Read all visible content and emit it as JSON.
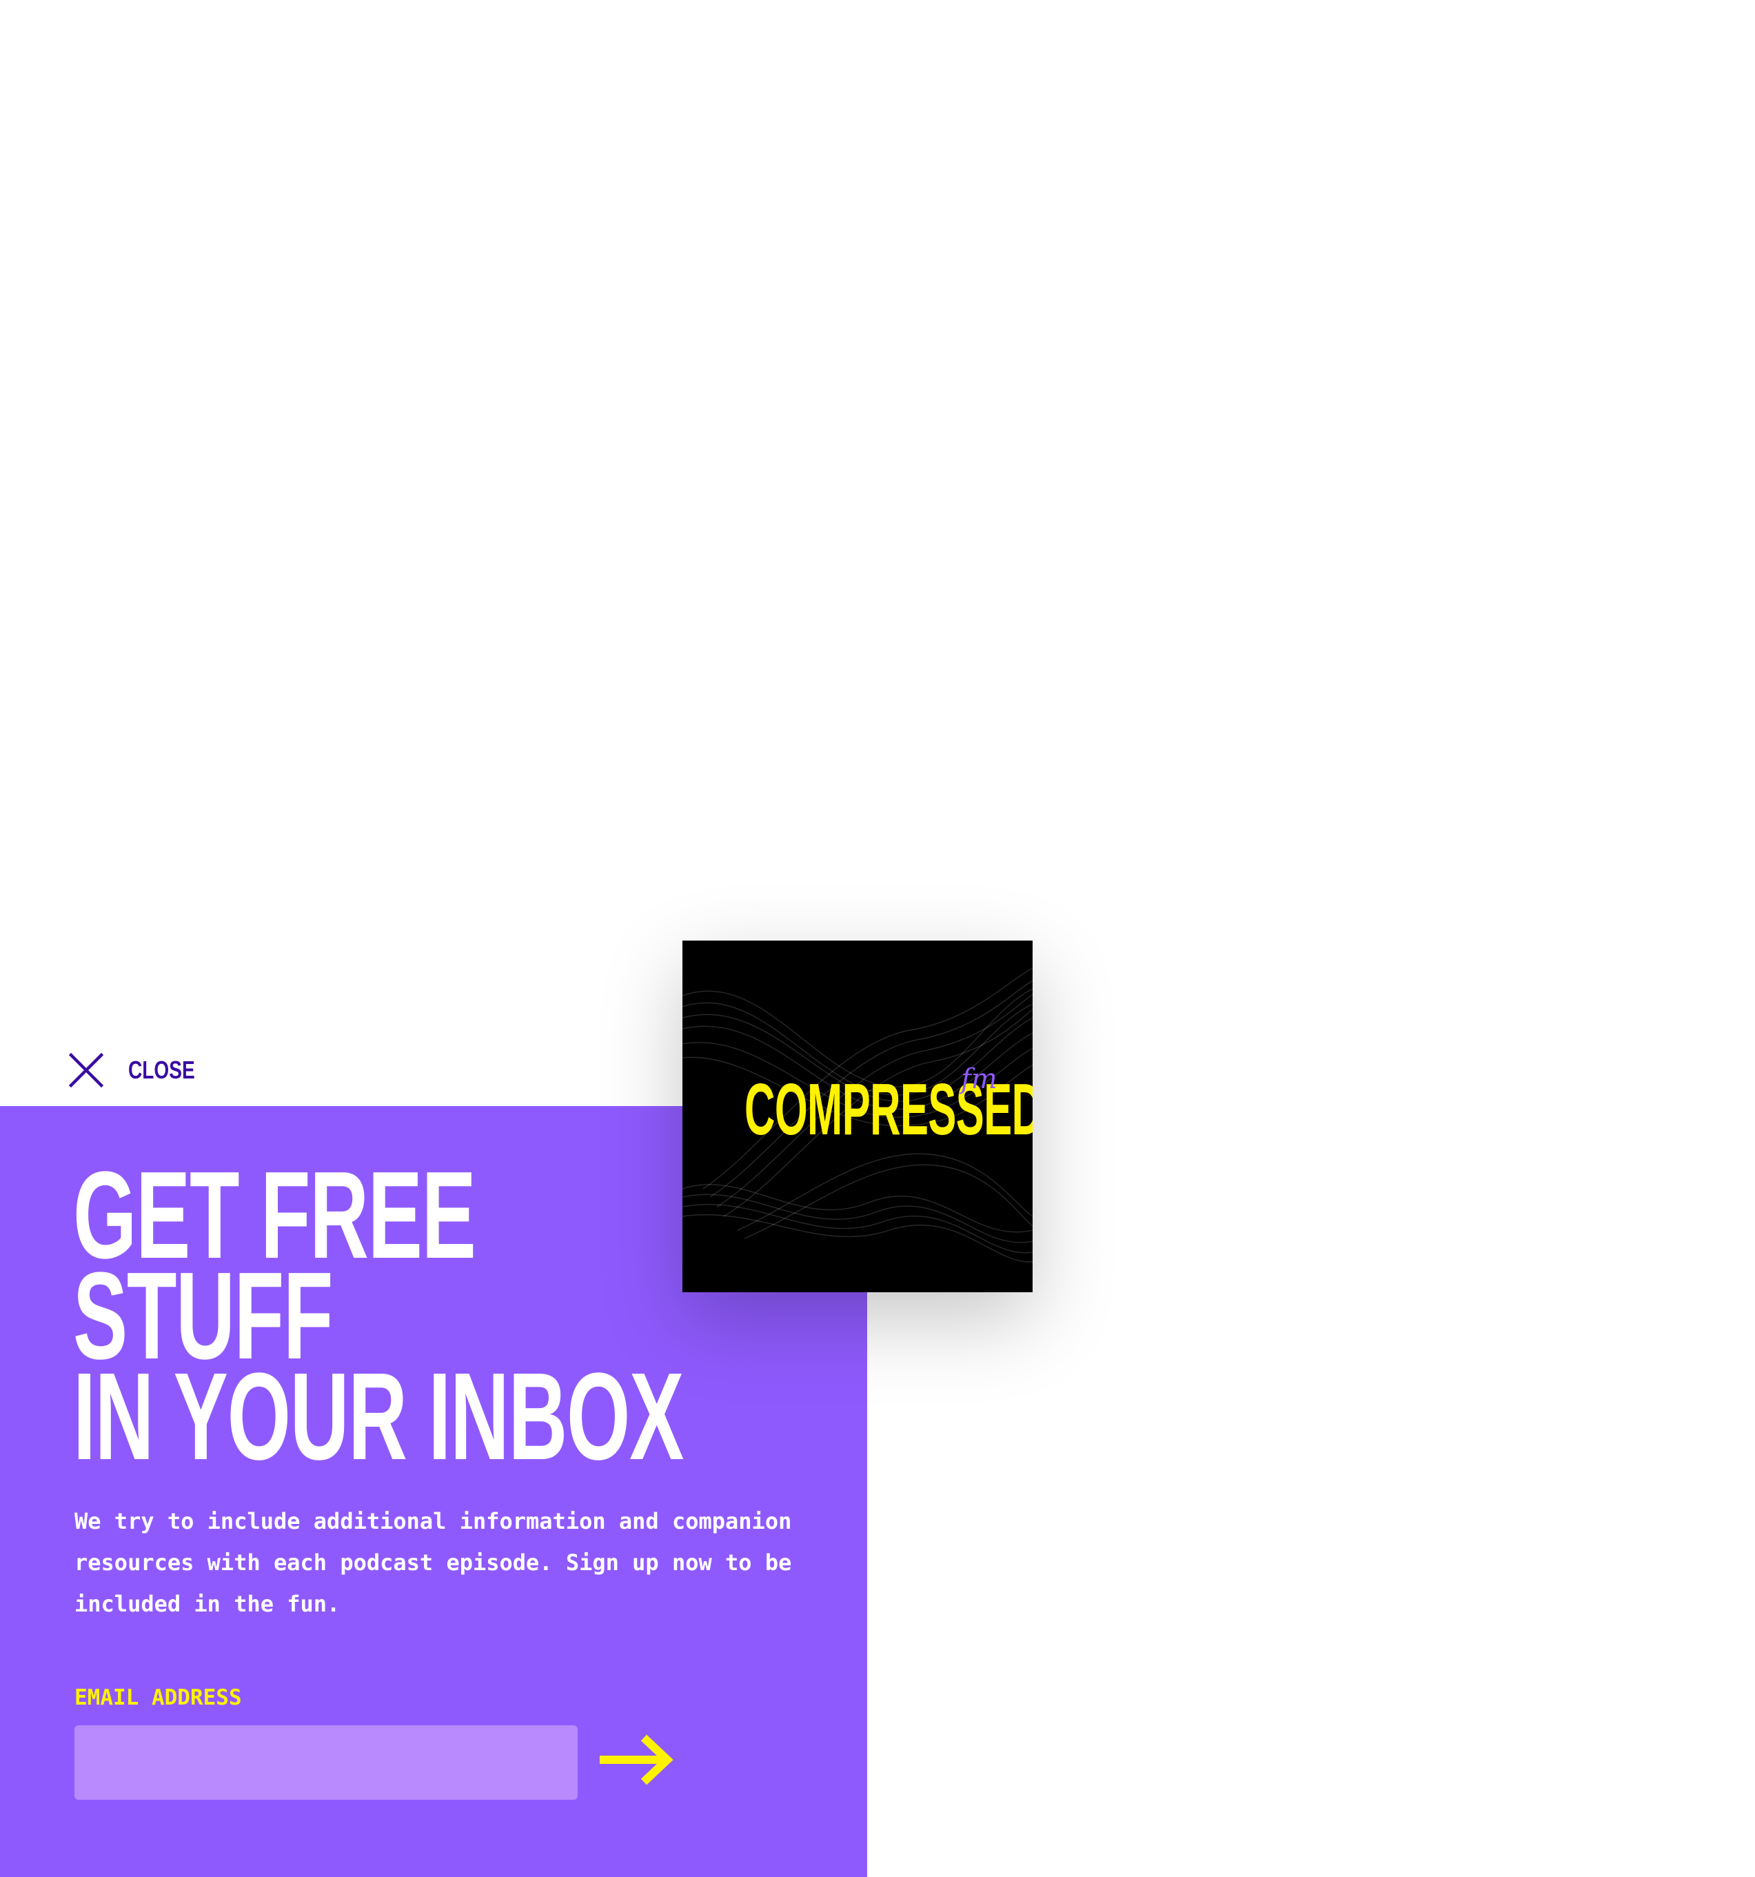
{
  "close": {
    "label": "CLOSE",
    "icon": "close-icon"
  },
  "colors": {
    "panel": "#8f5afd",
    "accent": "#fff200",
    "input": "#b98afd",
    "close": "#3a0ca3"
  },
  "signup": {
    "headline_lines": [
      "GET FREE",
      "STUFF",
      "IN YOUR INBOX"
    ],
    "body": "We try to include additional information and companion resources with each podcast episode. Sign up now to be included in the fun.",
    "email_label": "EMAIL ADDRESS",
    "email_value": "",
    "email_placeholder": "",
    "submit_icon": "arrow-right-icon"
  },
  "artwork": {
    "title": "COMPRESSED",
    "suffix": "fm"
  }
}
